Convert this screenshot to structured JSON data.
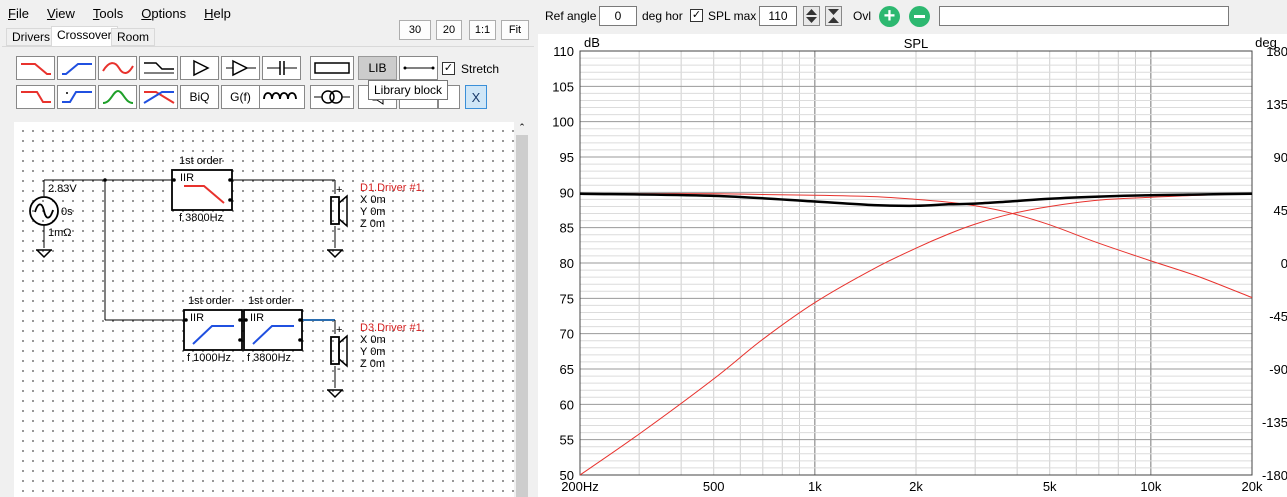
{
  "menu": [
    "File",
    "View",
    "Tools",
    "Options",
    "Help"
  ],
  "view_buttons": {
    "w30": "30",
    "w20": "20",
    "one_one": "1:1",
    "fit": "Fit"
  },
  "tabs": [
    "Drivers",
    "Crossover",
    "Room"
  ],
  "toolbar": {
    "lib": "LIB",
    "stretch": "Stretch",
    "biq": "BiQ",
    "gf": "G(f)",
    "x": "X",
    "tooltip": "Library block"
  },
  "schematic": {
    "source": {
      "voltage": "2.83V",
      "delay": "0s",
      "impedance": "1mΩ"
    },
    "block1": {
      "header": "1st order",
      "type": "IIR",
      "freq_label": "f   3800Hz"
    },
    "block2": {
      "header": "1st order",
      "type": "IIR",
      "freq_label": "f   1000Hz"
    },
    "block3": {
      "header": "1st order",
      "type": "IIR",
      "freq_label": "f   3800Hz"
    },
    "driver1": {
      "name": "D1.Driver #1.",
      "x": "X 0m",
      "y": "Y 0m",
      "z": "Z 0m"
    },
    "driver2": {
      "name": "D3.Driver #1.",
      "x": "X 0m",
      "y": "Y 0m",
      "z": "Z 0m"
    }
  },
  "plot_controls": {
    "ref_angle_label": "Ref angle",
    "ref_angle_value": "0",
    "deg_hor": "deg hor",
    "spl_max_label": "SPL max",
    "spl_max_value": "110",
    "ovl": "Ovl",
    "ovl_field": ""
  },
  "colors": {
    "driver_trace": "#e8322d",
    "sum_trace": "#000000",
    "driver_label": "#d42020",
    "plus": "#2db870"
  },
  "chart_data": {
    "type": "line",
    "title": "SPL",
    "ylabel": "dB",
    "y2label": "deg",
    "xscale": "log",
    "xlim": [
      200,
      20000
    ],
    "ylim": [
      50,
      110
    ],
    "y2lim": [
      -180,
      180
    ],
    "xticks": [
      {
        "v": 200,
        "label": "200Hz"
      },
      {
        "v": 500,
        "label": "500"
      },
      {
        "v": 1000,
        "label": "1k"
      },
      {
        "v": 2000,
        "label": "2k"
      },
      {
        "v": 5000,
        "label": "5k"
      },
      {
        "v": 10000,
        "label": "10k"
      },
      {
        "v": 20000,
        "label": "20k"
      }
    ],
    "yticks": [
      110,
      105,
      100,
      95,
      90,
      85,
      80,
      75,
      70,
      65,
      60,
      55,
      50
    ],
    "y2ticks": [
      180,
      135,
      90,
      45,
      0,
      -45,
      -90,
      -135,
      -180
    ],
    "series": [
      {
        "color": "#e8322d",
        "width": 1,
        "x": [
          200,
          300,
          500,
          700,
          1000,
          1500,
          2000,
          2500,
          3000,
          3800,
          5000,
          7000,
          10000,
          14000,
          20000
        ],
        "y": [
          89.8,
          89.8,
          89.8,
          89.7,
          89.6,
          89.4,
          89.0,
          88.6,
          88.1,
          87.1,
          85.4,
          82.8,
          80.3,
          78.0,
          75.1
        ]
      },
      {
        "color": "#e8322d",
        "width": 1,
        "x": [
          200,
          300,
          500,
          700,
          1000,
          1500,
          2000,
          2500,
          3000,
          3800,
          5000,
          7000,
          10000,
          14000,
          20000
        ],
        "y": [
          50.0,
          55.8,
          63.6,
          69.2,
          74.4,
          79.2,
          82.1,
          84.1,
          85.5,
          86.9,
          88.0,
          88.9,
          89.3,
          89.6,
          89.8
        ]
      },
      {
        "color": "#000000",
        "width": 2.5,
        "x": [
          200,
          500,
          1000,
          1500,
          2000,
          2500,
          3000,
          3800,
          5000,
          7000,
          10000,
          14000,
          20000
        ],
        "y": [
          89.8,
          89.5,
          88.7,
          88.2,
          88.1,
          88.3,
          88.4,
          88.7,
          89.1,
          89.4,
          89.6,
          89.7,
          89.8
        ]
      }
    ]
  }
}
